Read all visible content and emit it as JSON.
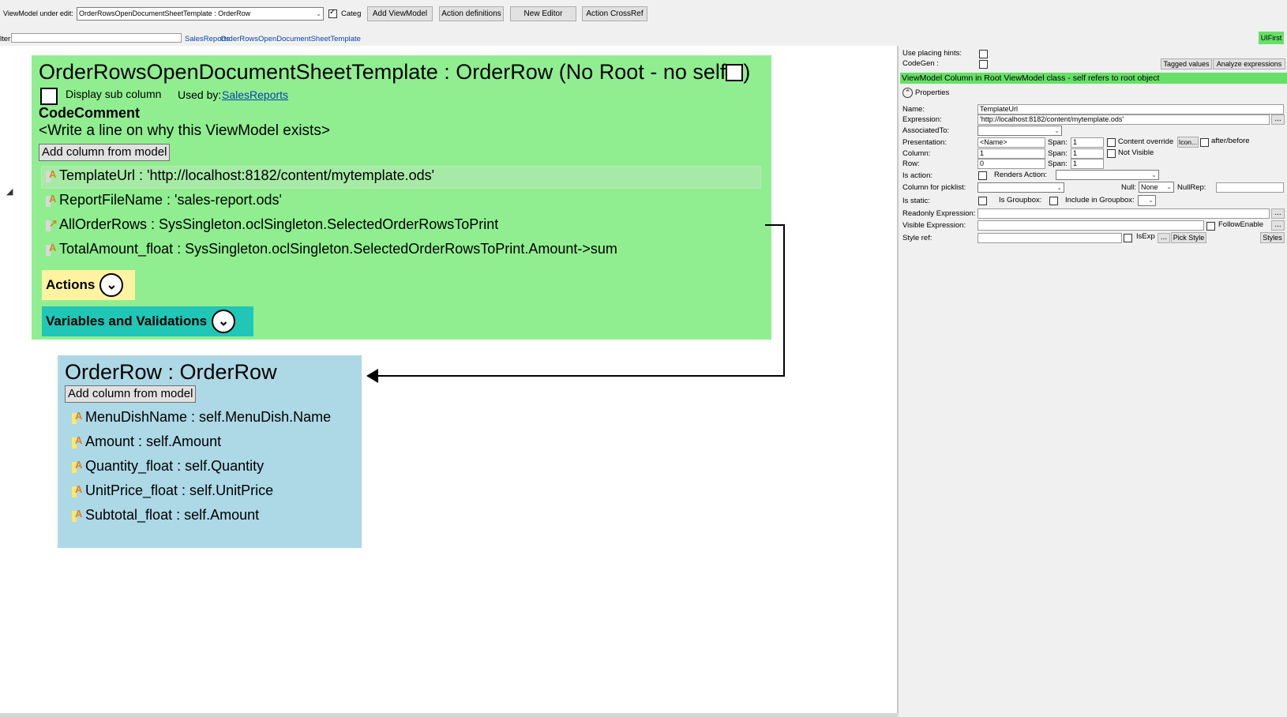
{
  "toolbar": {
    "vm_label": "ViewModel under edit:",
    "vm_value": "OrderRowsOpenDocumentSheetTemplate : OrderRow",
    "categ_label": "Categ",
    "add_viewmodel": "Add ViewModel",
    "action_definitions": "Action definitions",
    "new_editor": "New Editor",
    "action_crossref": "Action CrossRef"
  },
  "filter": {
    "label": "lter:",
    "breadcrumb_1": "SalesReports",
    "breadcrumb_2": "OrderRowsOpenDocumentSheetTemplate"
  },
  "uifirst": "UIFirst",
  "main_vm": {
    "title": "OrderRowsOpenDocumentSheetTemplate : OrderRow  (No Root - no self",
    "title_end": ")",
    "display_sub_columns": "Display sub column",
    "used_by_label": "Used by:",
    "used_by_link": "SalesReports",
    "code_comment_heading": "CodeComment",
    "code_comment_text": "<Write a line on why this ViewModel exists>",
    "add_column": "Add column from model",
    "columns": [
      {
        "text": "TemplateUrl : 'http://localhost:8182/content/mytemplate.ods'",
        "glyph": "A"
      },
      {
        "text": "ReportFileName : 'sales-report.ods'",
        "glyph": "A"
      },
      {
        "text": "AllOrderRows : SysSingleton.oclSingleton.SelectedOrderRowsToPrint",
        "glyph": "↗"
      },
      {
        "text": "TotalAmount_float : SysSingleton.oclSingleton.SelectedOrderRowsToPrint.Amount->sum",
        "glyph": "A"
      }
    ],
    "actions_label": "Actions",
    "variables_label": "Variables and Validations"
  },
  "sub_vm": {
    "title": "OrderRow : OrderRow",
    "add_column": "Add column from model",
    "columns": [
      {
        "text": "MenuDishName : self.MenuDish.Name",
        "glyph": "A"
      },
      {
        "text": "Amount : self.Amount",
        "glyph": "A"
      },
      {
        "text": "Quantity_float : self.Quantity",
        "glyph": "A"
      },
      {
        "text": "UnitPrice_float : self.UnitPrice",
        "glyph": "A"
      },
      {
        "text": "Subtotal_float : self.Amount",
        "glyph": "A"
      }
    ]
  },
  "panel": {
    "use_placing_hints": "Use placing hints:",
    "codegen": "CodeGen :",
    "tagged_values": "Tagged values",
    "analyze_expressions": "Analyze expressions",
    "header": "ViewModel Column in Root ViewModel class - self refers to root object",
    "properties": "Properties",
    "name_label": "Name:",
    "name_value": "TemplateUrl",
    "expression_label": "Expression:",
    "expression_value": "'http://localhost:8182/content/mytemplate.ods'",
    "associated_label": "AssociatedTo:",
    "presentation_label": "Presentation:",
    "presentation_value": "<Name>",
    "span_label": "Span:",
    "span_pres": "1",
    "content_override": "Content override",
    "icon_btn": "Icon...",
    "after_before": "after/before",
    "column_label": "Column:",
    "column_value": "1",
    "span_col": "1",
    "not_visible": "Not Visible",
    "row_label": "Row:",
    "row_value": "0",
    "span_row": "1",
    "is_action_label": "Is action:",
    "renders_action": "Renders Action:",
    "picklist_label": "Column for picklist:",
    "null_label": "Null:",
    "null_value": "None",
    "nullrep_label": "NullRep:",
    "is_static_label": "Is static:",
    "is_groupbox": "Is Groupbox:",
    "include_groupbox": "Include in Groupbox:",
    "readonly_label": "Readonly Expression:",
    "visible_label": "Visible Expression:",
    "follow_enable": "FollowEnable",
    "styleref_label": "Style ref:",
    "isexp": "IsExp",
    "pick_style": "Pick Style",
    "styles": "Styles",
    "ellipsis": "..."
  },
  "colors": {
    "green_vm": "#90ee90",
    "blue_vm": "#add8e6",
    "actions_bg": "#fff2a0",
    "variables_bg": "#20c6b6",
    "panel_header": "#66e066",
    "link": "#0645ad"
  }
}
